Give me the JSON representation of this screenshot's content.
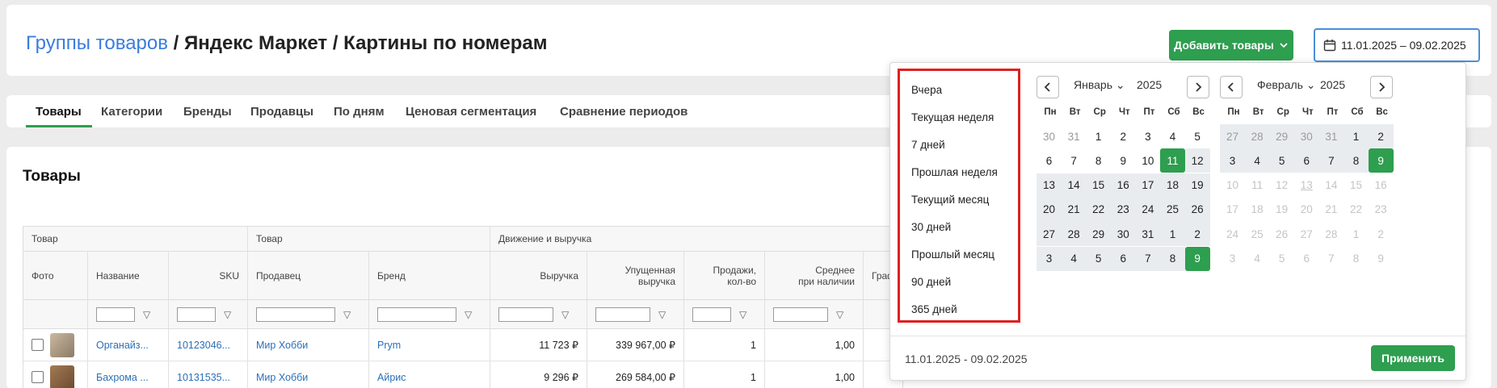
{
  "header": {
    "breadcrumb_link": "Группы товаров",
    "breadcrumb_rest": " / Яндекс Маркет / Картины по номерам",
    "add_button": "Добавить товары",
    "date_range": "11.01.2025 – 09.02.2025"
  },
  "tabs": [
    {
      "label": "Товары"
    },
    {
      "label": "Категории"
    },
    {
      "label": "Бренды"
    },
    {
      "label": "Продавцы"
    },
    {
      "label": "По дням"
    },
    {
      "label": "Ценовая сегментация"
    },
    {
      "label": "Сравнение периодов"
    }
  ],
  "section": {
    "title": "Товары"
  },
  "table": {
    "groups": [
      "Товар",
      "Товар",
      "Движение и выручка"
    ],
    "columns": [
      "Фото",
      "Название",
      "SKU",
      "Продавец",
      "Бренд",
      "Выручка",
      "Упущенная выручка",
      "Продажи, кол-во",
      "Среднее при наличии",
      "Граф"
    ],
    "rows": [
      {
        "name": "Органайз...",
        "sku": "10123046...",
        "seller": "Мир Хобби",
        "brand": "Prym",
        "revenue": "11 723 ₽",
        "lost": "339 967,00 ₽",
        "sales": "1",
        "avg": "1,00"
      },
      {
        "name": "Бахрома ...",
        "sku": "10131535...",
        "seller": "Мир Хобби",
        "brand": "Айрис",
        "revenue": "9 296 ₽",
        "lost": "269 584,00 ₽",
        "sales": "1",
        "avg": "1,00"
      }
    ]
  },
  "picker": {
    "presets": [
      "Вчера",
      "Текущая неделя",
      "7 дней",
      "Прошлая неделя",
      "Текущий месяц",
      "30 дней",
      "Прошлый месяц",
      "90 дней",
      "365 дней"
    ],
    "weekdays": [
      "Пн",
      "Вт",
      "Ср",
      "Чт",
      "Пт",
      "Сб",
      "Вс"
    ],
    "left": {
      "month": "Январь",
      "year": "2025",
      "days": [
        "30",
        "31",
        "1",
        "2",
        "3",
        "4",
        "5",
        "6",
        "7",
        "8",
        "9",
        "10",
        "11",
        "12",
        "13",
        "14",
        "15",
        "16",
        "17",
        "18",
        "19",
        "20",
        "21",
        "22",
        "23",
        "24",
        "25",
        "26",
        "27",
        "28",
        "29",
        "30",
        "31",
        "1",
        "2",
        "3",
        "4",
        "5",
        "6",
        "7",
        "8",
        "9"
      ]
    },
    "right": {
      "month": "Февраль",
      "year": "2025",
      "days": [
        "27",
        "28",
        "29",
        "30",
        "31",
        "1",
        "2",
        "3",
        "4",
        "5",
        "6",
        "7",
        "8",
        "9",
        "10",
        "11",
        "12",
        "13",
        "14",
        "15",
        "16",
        "17",
        "18",
        "19",
        "20",
        "21",
        "22",
        "23",
        "24",
        "25",
        "26",
        "27",
        "28",
        "1",
        "2",
        "3",
        "4",
        "5",
        "6",
        "7",
        "8",
        "9"
      ]
    },
    "range_text": "11.01.2025 - 09.02.2025",
    "apply_button": "Применить"
  }
}
